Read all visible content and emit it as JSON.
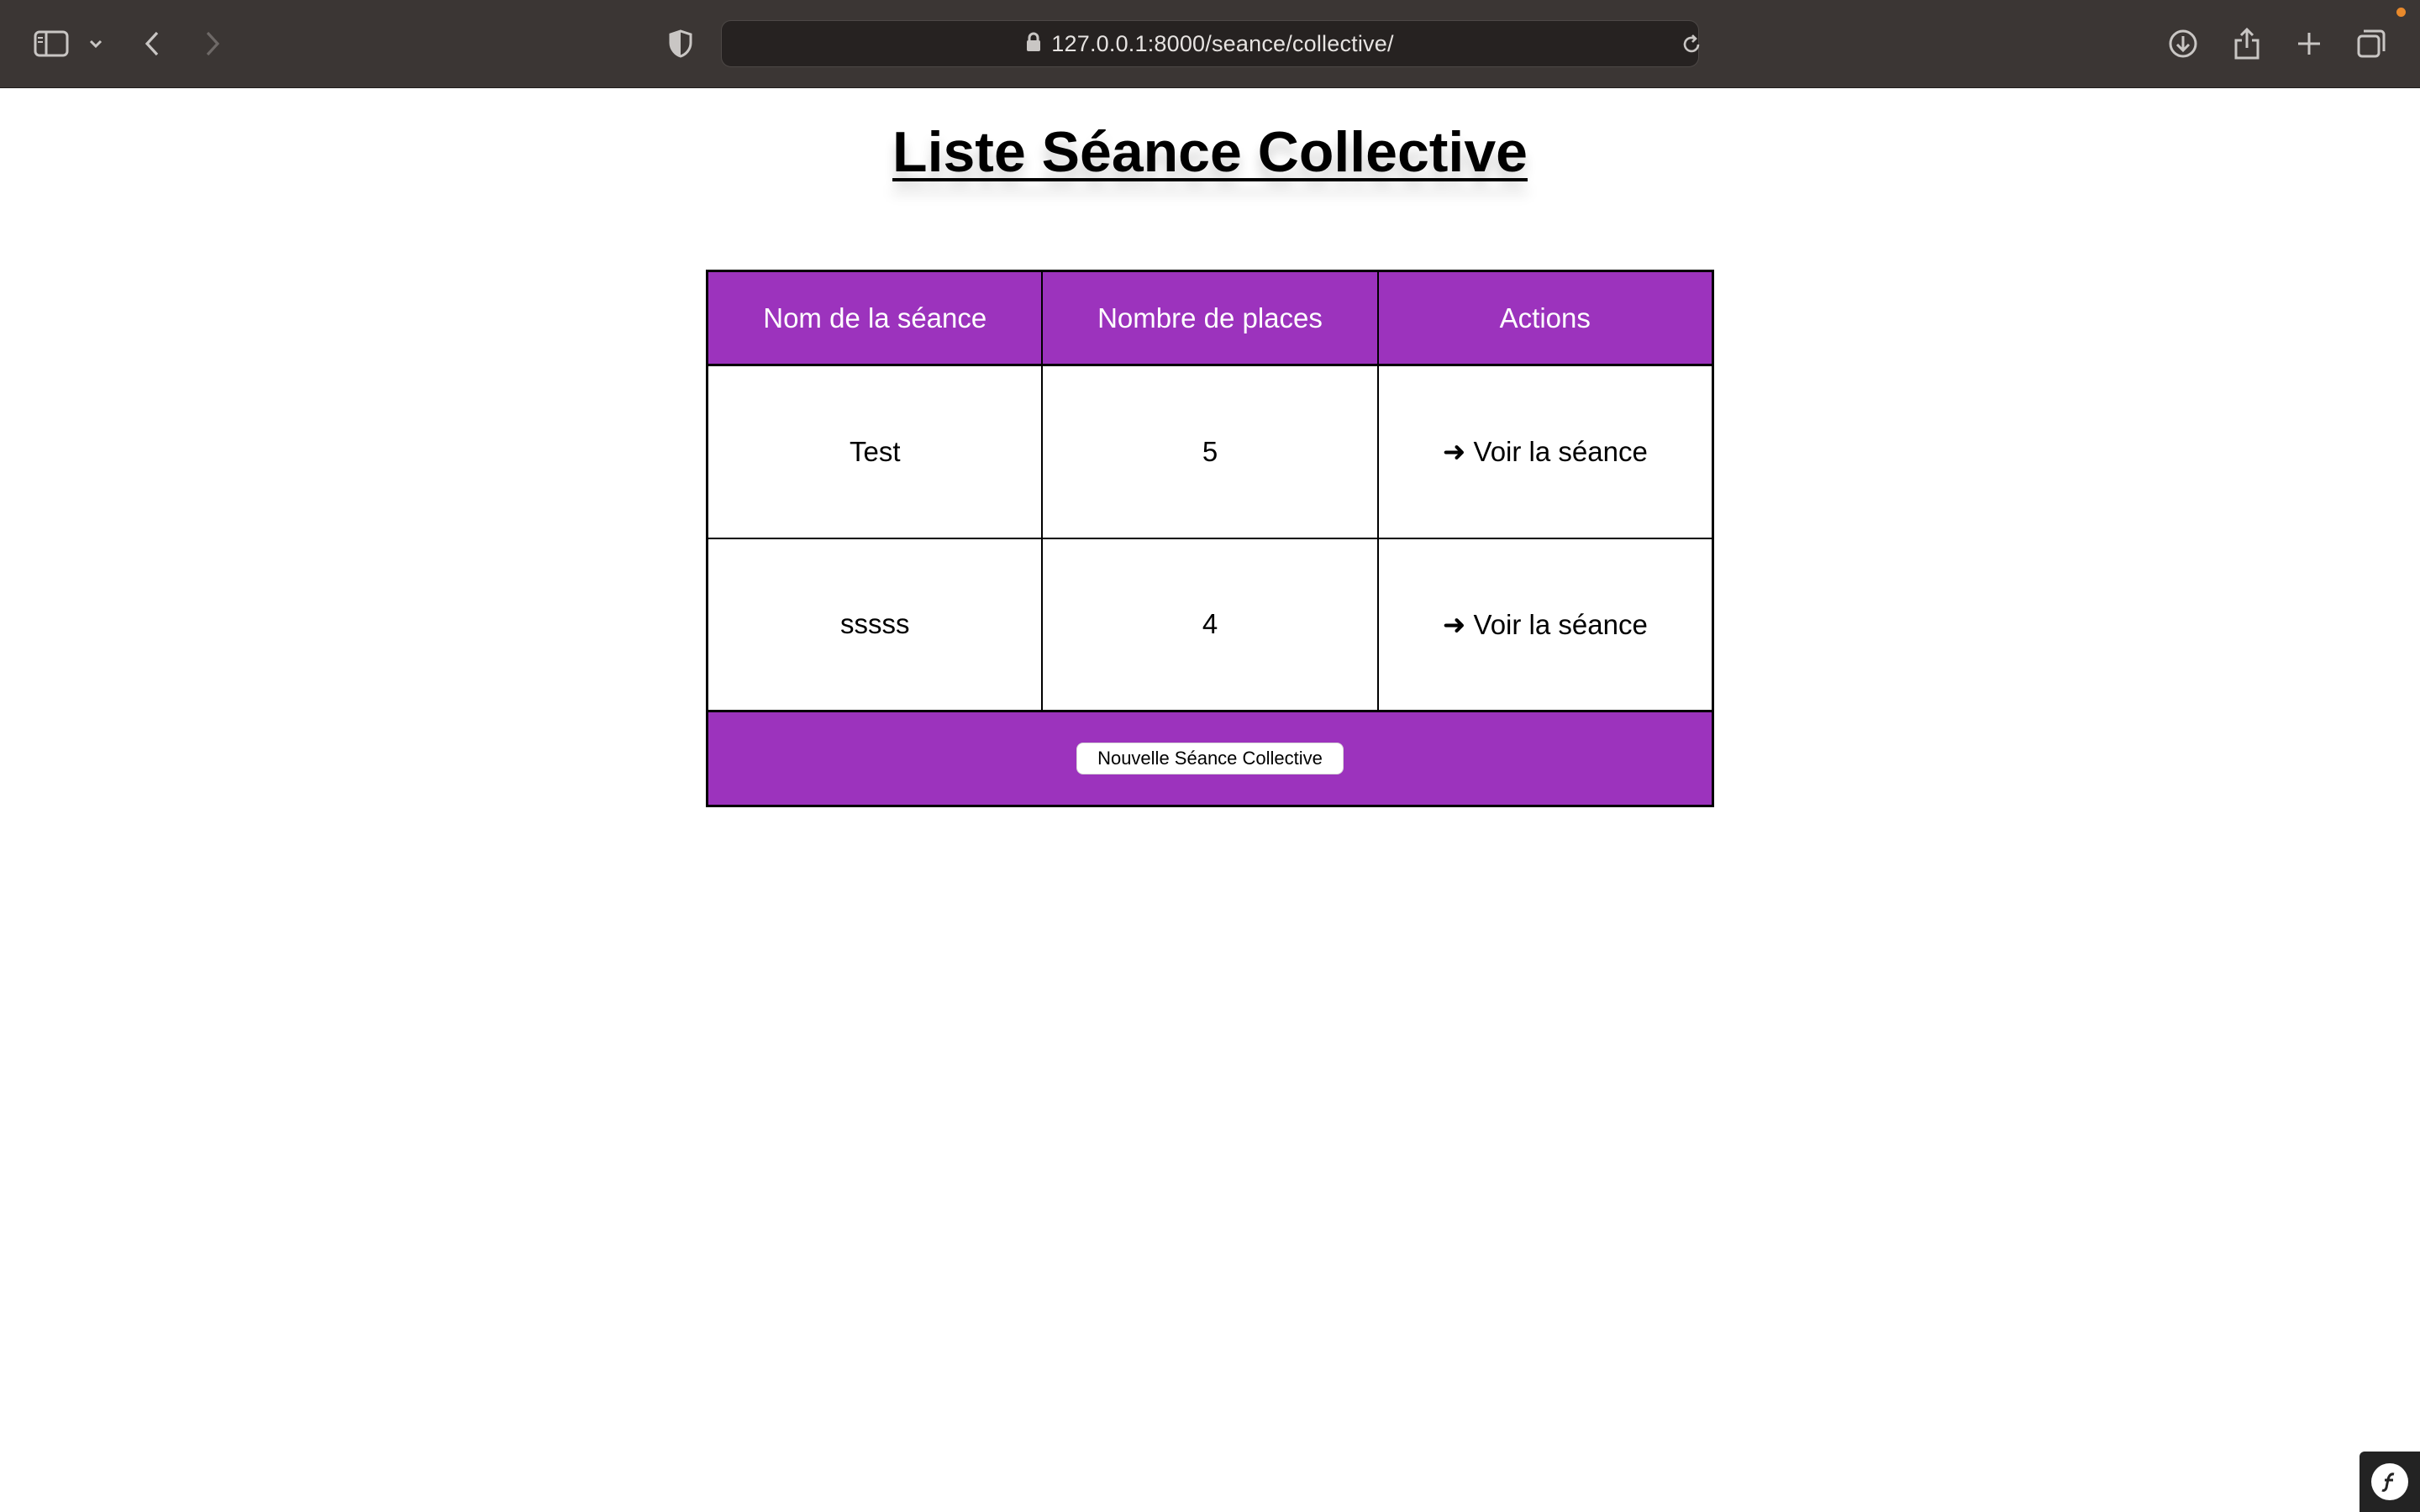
{
  "browser": {
    "url": "127.0.0.1:8000/seance/collective/",
    "icons": {
      "sidebar": "sidebar-icon",
      "sidebar_menu": "chevron-down-icon",
      "back": "chevron-left-icon",
      "forward": "chevron-right-icon",
      "privacy": "shield-icon",
      "lock": "lock-icon",
      "reload": "reload-icon",
      "downloads": "download-icon",
      "share": "share-icon",
      "new_tab": "plus-icon",
      "tab_overview": "tabs-icon"
    }
  },
  "page": {
    "title": "Liste Séance Collective",
    "table": {
      "headers": [
        "Nom de la séance",
        "Nombre de places",
        "Actions"
      ],
      "rows": [
        {
          "name": "Test",
          "places": "5",
          "action": "➜ Voir la séance"
        },
        {
          "name": "sssss",
          "places": "4",
          "action": "➜ Voir la séance"
        }
      ]
    },
    "new_button_label": "Nouvelle Séance Collective",
    "debug_badge": "symfony-icon"
  },
  "colors": {
    "accent": "#9c33bd",
    "toolbar": "#3b3634"
  }
}
